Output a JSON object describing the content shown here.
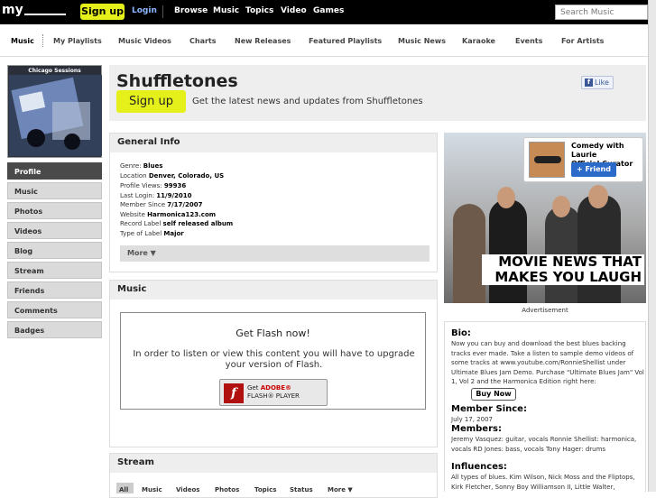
{
  "topbar": {
    "logo": "my",
    "signup": "Sign up",
    "login": "Login",
    "nav": [
      "Browse",
      "Music",
      "Topics",
      "Video",
      "Games"
    ],
    "search_placeholder": "Search Music"
  },
  "subnav": [
    "Music",
    "My Playlists",
    "Music Videos",
    "Charts",
    "New Releases",
    "Featured Playlists",
    "Music News",
    "Karaoke",
    "Events",
    "For Artists"
  ],
  "artwork_title": "Chicago Sessions",
  "sidebar": [
    "Profile",
    "Music",
    "Photos",
    "Videos",
    "Blog",
    "Stream",
    "Friends",
    "Comments",
    "Badges"
  ],
  "profile": {
    "name": "Shuffletones",
    "signup": "Sign up",
    "tagline": "Get the latest news and updates from Shuffletones",
    "like": "Like"
  },
  "general_info": {
    "heading": "General Info",
    "rows": [
      {
        "label": "Genre:",
        "value": "Blues"
      },
      {
        "label": "Location",
        "value": "Denver, Colorado, US"
      },
      {
        "label": "Profile Views:",
        "value": "99936"
      },
      {
        "label": "Last Login:",
        "value": "11/9/2010"
      },
      {
        "label": "Member Since",
        "value": "7/17/2007"
      },
      {
        "label": "Website",
        "value": "Harmonica123.com"
      },
      {
        "label": "Record Label",
        "value": "self released album"
      },
      {
        "label": "Type of Label",
        "value": "Major"
      }
    ],
    "more": "More ▼"
  },
  "music": {
    "heading": "Music",
    "flash_title": "Get Flash now!",
    "flash_body": "In order to listen or view this content you will have to upgrade your version of Flash.",
    "flash_btn_get": "Get",
    "flash_btn_adobe": "ADOBE®",
    "flash_btn_player": "FLASH® PLAYER"
  },
  "stream": {
    "heading": "Stream",
    "tabs": [
      "All",
      "Music",
      "Videos",
      "Photos",
      "Topics",
      "Status",
      "More ▼"
    ]
  },
  "ad": {
    "slogan_1": "MOVIE NEWS THAT",
    "slogan_2": "MAKES YOU LAUGH",
    "curator_name": "Comedy with Laurie",
    "curator_role": "Official Curator",
    "friend_btn": "+ Friend",
    "label": "Advertisement"
  },
  "bio": {
    "bio_heading": "Bio:",
    "bio_text": "Now you can buy and download the best blues backing tracks ever made. Take a listen to sample demo videos of some tracks at www.youtube.com/RonnieShellist under Ultimate Blues Jam Demo. Purchase \"Ultimate Blues Jam\" Vol 1, Vol 2 and the Harmonica Edition right here:",
    "buy_now": "Buy Now",
    "member_heading": "Member Since:",
    "member_value": "July 17, 2007",
    "members_heading": "Members:",
    "members_value": "Jeremy Vasquez: guitar, vocals Ronnie Shellist: harmonica, vocals RD Jones: bass, vocals Tony Hager: drums",
    "influences_heading": "Influences:",
    "influences_value": "All types of blues. Kim Wilson, Nick Moss and the Fliptops, Kirk Fletcher, Sonny Boy Williamson II, Little Walter,"
  }
}
